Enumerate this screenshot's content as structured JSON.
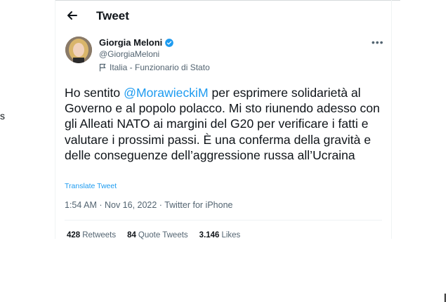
{
  "edge_left_text": "s",
  "header": {
    "title": "Tweet"
  },
  "author": {
    "name": "Giorgia Meloni",
    "handle": "@GiorgiaMeloni",
    "label": "Italia - Funzionario di Stato"
  },
  "tweet": {
    "text_before": "Ho sentito ",
    "mention": "@MorawieckiM",
    "text_after": " per esprimere solidarietà al Governo e al popolo polacco. Mi sto riunendo adesso con gli Alleati NATO ai margini del G20 per verificare i fatti e valutare i prossimi passi. È una conferma della gravità e delle conseguenze dell’aggressione russa all’Ucraina",
    "translate_label": "Translate Tweet",
    "meta": "1:54 AM · Nov 16, 2022 · Twitter for iPhone"
  },
  "stats": [
    {
      "count": "428",
      "label": "Retweets"
    },
    {
      "count": "84",
      "label": "Quote Tweets"
    },
    {
      "count": "3.146",
      "label": "Likes"
    }
  ],
  "colors": {
    "accent": "#1d9bf0",
    "muted": "#536471",
    "text": "#0f1419"
  }
}
